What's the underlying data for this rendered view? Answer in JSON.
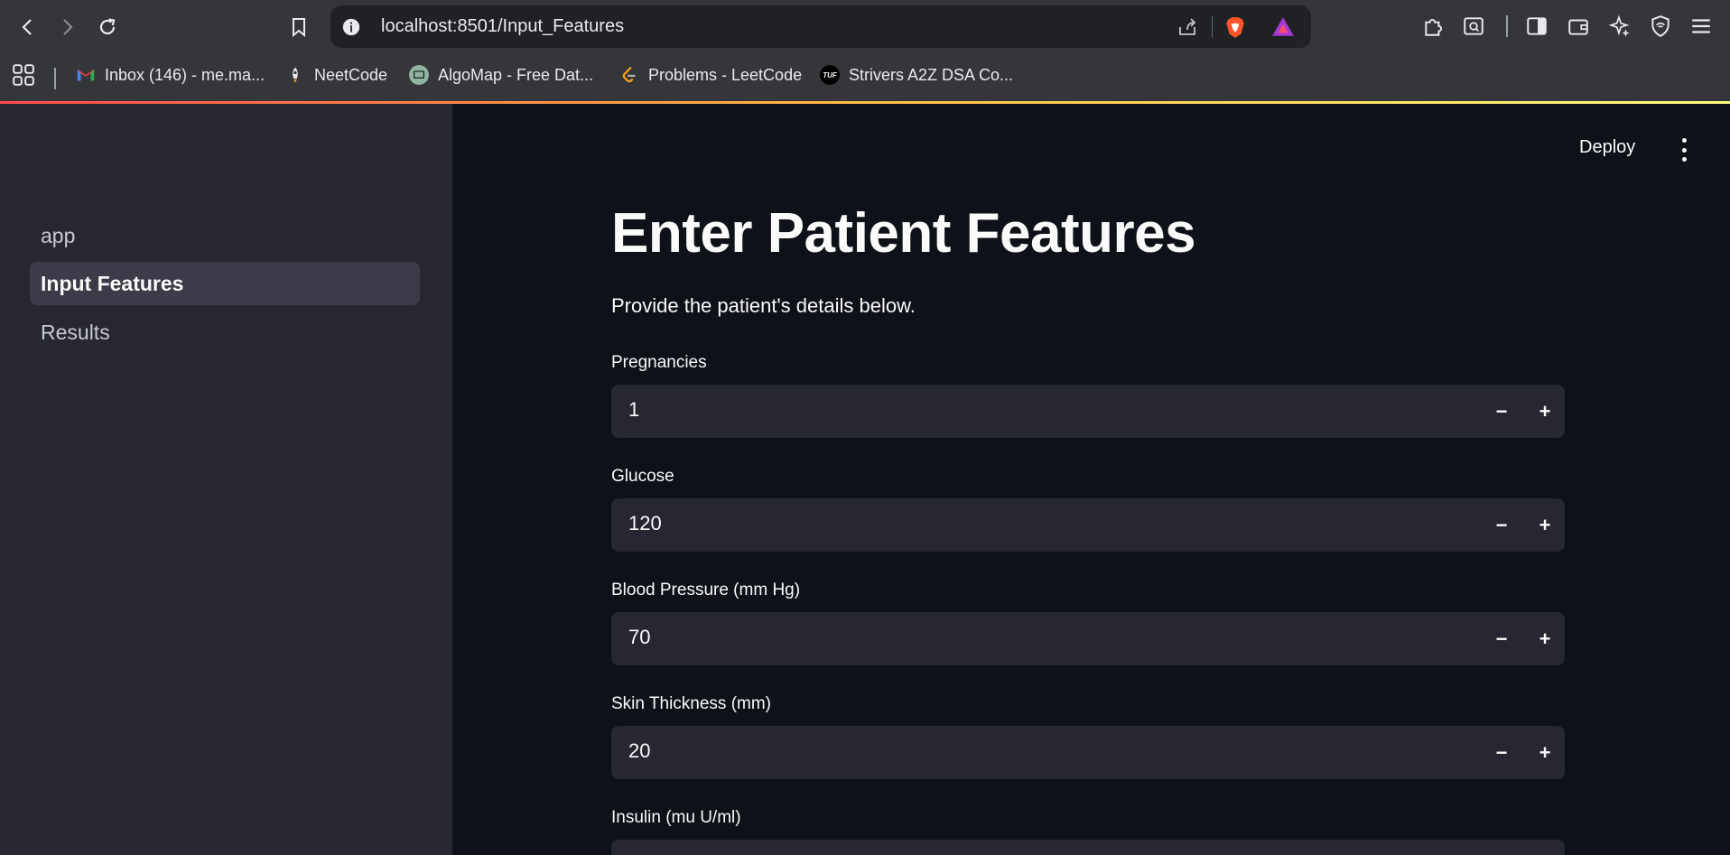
{
  "browser": {
    "url": "localhost:8501/Input_Features",
    "bookmarks": [
      {
        "label": "Inbox (146) - me.ma...",
        "icon": "gmail-icon"
      },
      {
        "label": "NeetCode",
        "icon": "rocket-icon"
      },
      {
        "label": "AlgoMap - Free Dat...",
        "icon": "algomap-icon"
      },
      {
        "label": "Problems - LeetCode",
        "icon": "leetcode-icon"
      },
      {
        "label": "Strivers A2Z DSA Co...",
        "icon": "tuf-icon"
      }
    ]
  },
  "sidebar": {
    "items": [
      {
        "label": "app",
        "active": false
      },
      {
        "label": "Input Features",
        "active": true
      },
      {
        "label": "Results",
        "active": false
      }
    ]
  },
  "header": {
    "deploy_label": "Deploy"
  },
  "main": {
    "title": "Enter Patient Features",
    "description": "Provide the patient's details below.",
    "fields": [
      {
        "label": "Pregnancies",
        "value": "1"
      },
      {
        "label": "Glucose",
        "value": "120"
      },
      {
        "label": "Blood Pressure (mm Hg)",
        "value": "70"
      },
      {
        "label": "Skin Thickness (mm)",
        "value": "20"
      },
      {
        "label": "Insulin (mu U/ml)",
        "value": ""
      }
    ],
    "minus_label": "−",
    "plus_label": "+"
  },
  "colors": {
    "accent": "#ff4b4b",
    "background": "#0e1117",
    "sidebar": "#262730"
  }
}
